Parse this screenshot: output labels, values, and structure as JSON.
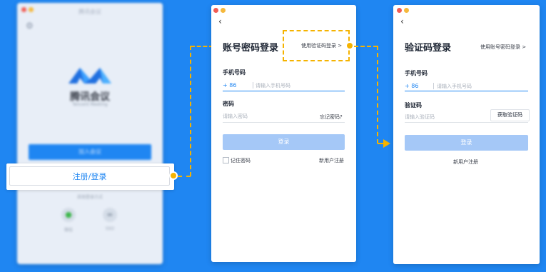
{
  "left_window": {
    "title": "腾讯会议",
    "brand": "腾讯会议",
    "brand_en": "Tencent Meeting",
    "join_label": "加入会议",
    "register_label": "注册/登录",
    "other_login": "其他登录方式",
    "icons": [
      {
        "icon": "wechat-icon",
        "label": "微信"
      },
      {
        "icon": "link-icon",
        "label": "SSO"
      }
    ]
  },
  "password_login": {
    "back": "‹",
    "title": "账号密码登录",
    "switch_link": "使用验证码登录 >",
    "phone_label": "手机号码",
    "phone_prefix": "+ 86",
    "phone_placeholder": "请输入手机号码",
    "password_label": "密码",
    "password_placeholder": "请输入密码",
    "forgot": "忘记密码?",
    "login_button": "登录",
    "remember": "记住密码",
    "new_user": "新用户注册"
  },
  "code_login": {
    "back": "‹",
    "title": "验证码登录",
    "switch_link": "使用账号密码登录 >",
    "phone_label": "手机号码",
    "phone_prefix": "+ 86",
    "phone_placeholder": "请输入手机号码",
    "code_label": "验证码",
    "code_placeholder": "请输入验证码",
    "get_code": "获取验证码",
    "login_button": "登录",
    "new_user": "新用户注册"
  },
  "colors": {
    "background": "#1f86f2",
    "accent": "#1f86f2",
    "connector": "#f5b300",
    "disabled_button": "#a5c8f7"
  }
}
